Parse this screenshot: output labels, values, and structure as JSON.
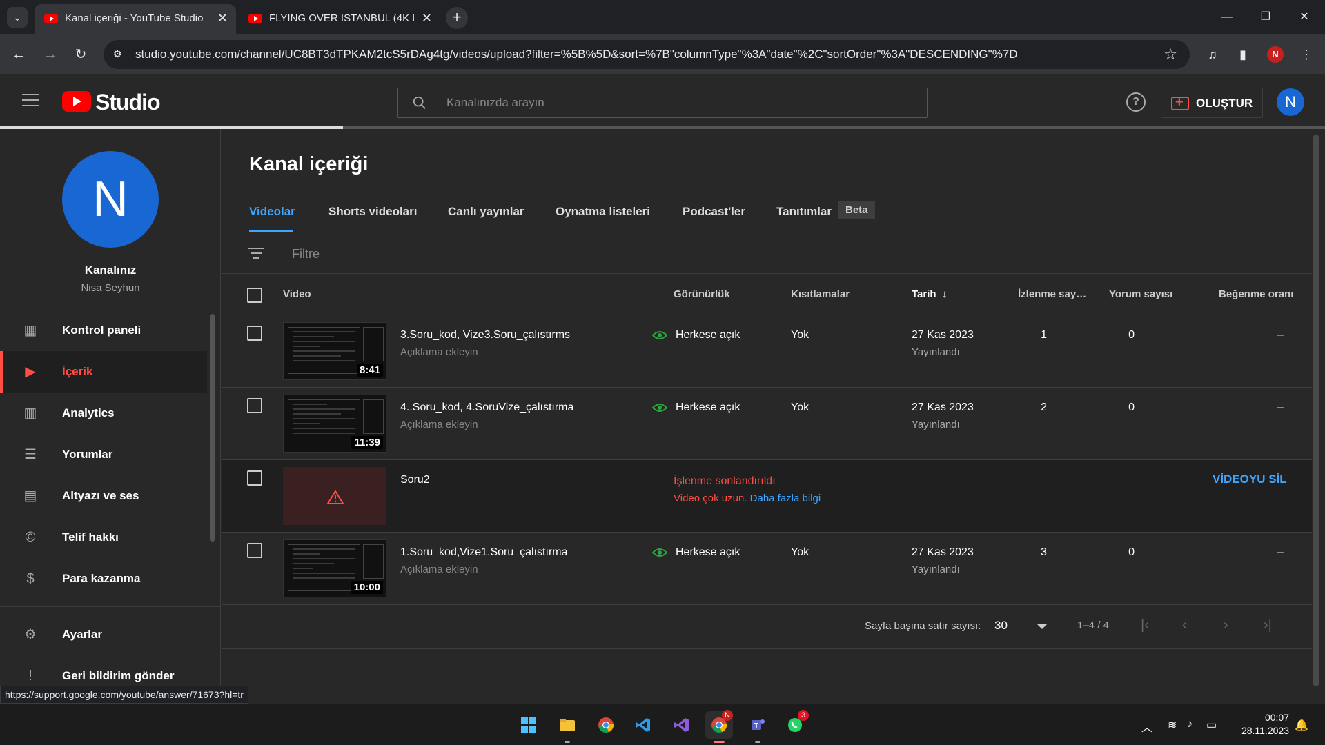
{
  "browser": {
    "tabs": [
      {
        "title": "Kanal içeriği - YouTube Studio"
      },
      {
        "title": "FLYING OVER ISTANBUL (4K U"
      }
    ],
    "url": "studio.youtube.com/channel/UC8BT3dTPKAM2tcS5rDAg4tg/videos/upload?filter=%5B%5D&sort=%7B\"columnType\"%3A\"date\"%2C\"sortOrder\"%3A\"DESCENDING\"%7D",
    "profile_initial": "N"
  },
  "header": {
    "logo_text": "Studio",
    "search_placeholder": "Kanalınızda arayın",
    "help_symbol": "?",
    "create_label": "OLUŞTUR",
    "avatar_initial": "N"
  },
  "sidebar": {
    "avatar_initial": "N",
    "channel_title": "Kanalınız",
    "channel_name": "Nisa Seyhun",
    "items": [
      {
        "label": "Kontrol paneli",
        "icon": "dashboard-icon"
      },
      {
        "label": "İçerik",
        "icon": "content-icon",
        "active": true
      },
      {
        "label": "Analytics",
        "icon": "analytics-icon"
      },
      {
        "label": "Yorumlar",
        "icon": "comments-icon"
      },
      {
        "label": "Altyazı ve ses",
        "icon": "subtitles-icon"
      },
      {
        "label": "Telif hakkı",
        "icon": "copyright-icon"
      },
      {
        "label": "Para kazanma",
        "icon": "monetization-icon"
      }
    ],
    "bottom_items": [
      {
        "label": "Ayarlar",
        "icon": "settings-icon"
      },
      {
        "label": "Geri bildirim gönder",
        "icon": "feedback-icon"
      }
    ]
  },
  "content": {
    "title": "Kanal içeriği",
    "tabs": [
      "Videolar",
      "Shorts videoları",
      "Canlı yayınlar",
      "Oynatma listeleri",
      "Podcast'ler",
      "Tanıtımlar"
    ],
    "beta_label": "Beta",
    "filter_placeholder": "Filtre",
    "columns": {
      "video": "Video",
      "visibility": "Görünürlük",
      "restrictions": "Kısıtlamalar",
      "date": "Tarih",
      "views": "İzlenme say…",
      "comments": "Yorum sayısı",
      "likes": "Beğenme oranı"
    },
    "rows": [
      {
        "title": "3.Soru_kod, Vize3.Soru_çalıstırms",
        "desc": "Açıklama ekleyin",
        "duration": "8:41",
        "visibility": "Herkese açık",
        "restrictions": "Yok",
        "date": "27 Kas 2023",
        "date_status": "Yayınlandı",
        "views": "1",
        "comments": "0",
        "likes": "–"
      },
      {
        "title": "4..Soru_kod, 4.SoruVize_çalıstırma",
        "desc": "Açıklama ekleyin",
        "duration": "11:39",
        "visibility": "Herkese açık",
        "restrictions": "Yok",
        "date": "27 Kas 2023",
        "date_status": "Yayınlandı",
        "views": "2",
        "comments": "0",
        "likes": "–"
      },
      {
        "title": "Soru2",
        "error_title": "İşlenme sonlandırıldı",
        "error_text": "Video çok uzun.",
        "error_link": "Daha fazla bilgi",
        "delete_label": "VİDEOYU SİL"
      },
      {
        "title": "1.Soru_kod,Vize1.Soru_çalıstırma",
        "desc": "Açıklama ekleyin",
        "duration": "10:00",
        "visibility": "Herkese açık",
        "restrictions": "Yok",
        "date": "27 Kas 2023",
        "date_status": "Yayınlandı",
        "views": "3",
        "comments": "0",
        "likes": "–"
      }
    ],
    "pager": {
      "rows_label": "Sayfa başına satır sayısı:",
      "rows_value": "30",
      "range": "1–4 / 4"
    }
  },
  "status_url": "https://support.google.com/youtube/answer/71673?hl=tr",
  "taskbar": {
    "apps": [
      "windows-start",
      "file-explorer",
      "chrome",
      "vscode",
      "visual-studio",
      "chrome-profile",
      "teams",
      "whatsapp"
    ],
    "chrome_badge": "N",
    "whatsapp_badge": "3",
    "time": "00:07",
    "date": "28.11.2023"
  },
  "colors": {
    "accent": "#3ea6ff",
    "brand": "#ff0000",
    "error": "#ff4e45",
    "background": "#282828"
  }
}
